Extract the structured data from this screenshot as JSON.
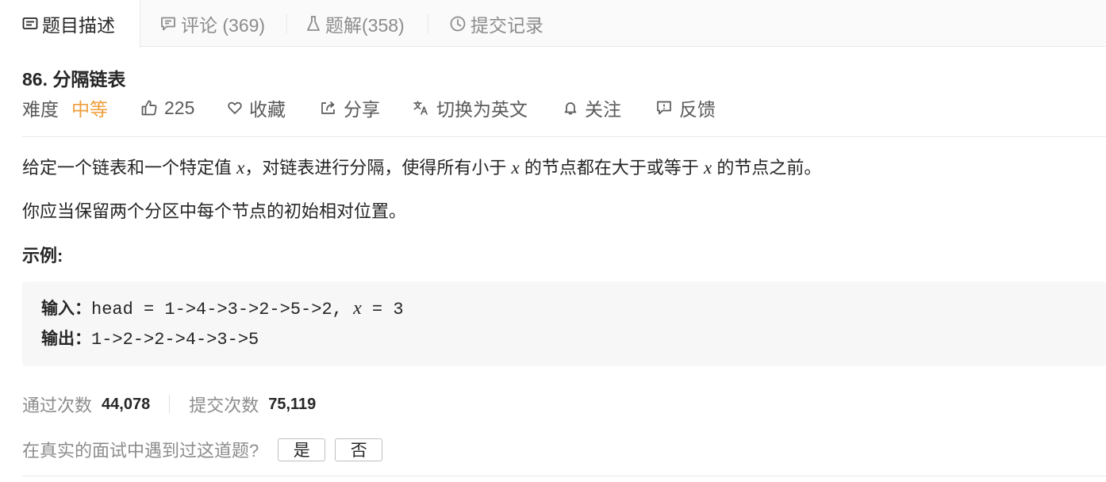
{
  "tabs": [
    {
      "label": "题目描述",
      "icon": "description-icon"
    },
    {
      "label": "评论 (369)",
      "icon": "comment-icon"
    },
    {
      "label": "题解(358)",
      "icon": "flask-icon"
    },
    {
      "label": "提交记录",
      "icon": "clock-icon"
    }
  ],
  "problem": {
    "title": "86. 分隔链表",
    "difficulty_label": "难度",
    "difficulty_value": "中等",
    "difficulty_color": "#ef9d3a",
    "likes": "225",
    "favorite_label": "收藏",
    "share_label": "分享",
    "switch_lang_label": "切换为英文",
    "follow_label": "关注",
    "feedback_label": "反馈"
  },
  "description": {
    "p1_a": "给定一个链表和一个特定值",
    "var_x": "x",
    "p1_b": "，对链表进行分隔，使得所有小于",
    "p1_c": "的节点都在大于或等于",
    "p1_d": "的节点之前。",
    "p2": "你应当保留两个分区中每个节点的初始相对位置。",
    "example_title": "示例:"
  },
  "example": {
    "input_label": "输入：",
    "input_value": "head = 1->4->3->2->5->2, ",
    "input_x": "x",
    "input_tail": " = 3",
    "output_label": "输出：",
    "output_value": "1->2->2->4->3->5"
  },
  "stats": {
    "accepted_label": "通过次数",
    "accepted_value": "44,078",
    "submitted_label": "提交次数",
    "submitted_value": "75,119"
  },
  "interview": {
    "question": "在真实的面试中遇到过这道题?",
    "yes": "是",
    "no": "否"
  }
}
